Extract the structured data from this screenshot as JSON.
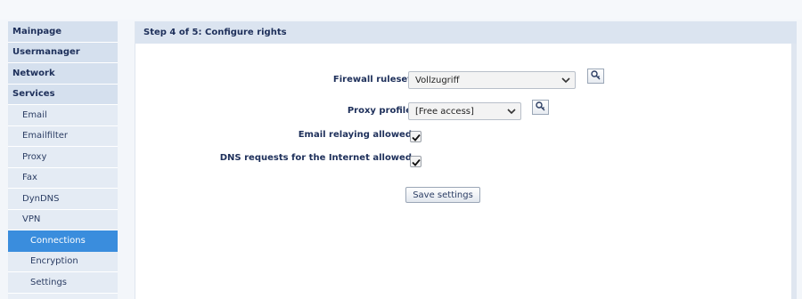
{
  "sidebar": {
    "items": [
      {
        "label": "Mainpage"
      },
      {
        "label": "Usermanager"
      },
      {
        "label": "Network"
      },
      {
        "label": "Services"
      },
      {
        "label": "Email"
      },
      {
        "label": "Emailfilter"
      },
      {
        "label": "Proxy"
      },
      {
        "label": "Fax"
      },
      {
        "label": "DynDNS"
      },
      {
        "label": "VPN"
      },
      {
        "label": "Connections"
      },
      {
        "label": "Encryption"
      },
      {
        "label": "Settings"
      }
    ],
    "active_item": "Connections"
  },
  "panel": {
    "title": "Step 4 of 5: Configure rights"
  },
  "form": {
    "firewall_label": "Firewall ruleset",
    "firewall_value": "Vollzugriff",
    "proxy_label": "Proxy profile",
    "proxy_value": "[Free access]",
    "email_relay_label": "Email relaying allowed",
    "email_relay_checked": true,
    "dns_label": "DNS requests for the Internet allowed",
    "dns_checked": true,
    "save_label": "Save settings"
  },
  "icons": {
    "dropdown": "chevron-down-icon",
    "lookup": "key-icon",
    "check": "checkmark-icon"
  },
  "colors": {
    "active_nav": "#3a8ddd",
    "header_bg": "#dbe4f0",
    "label_text": "#1d2f5a"
  }
}
